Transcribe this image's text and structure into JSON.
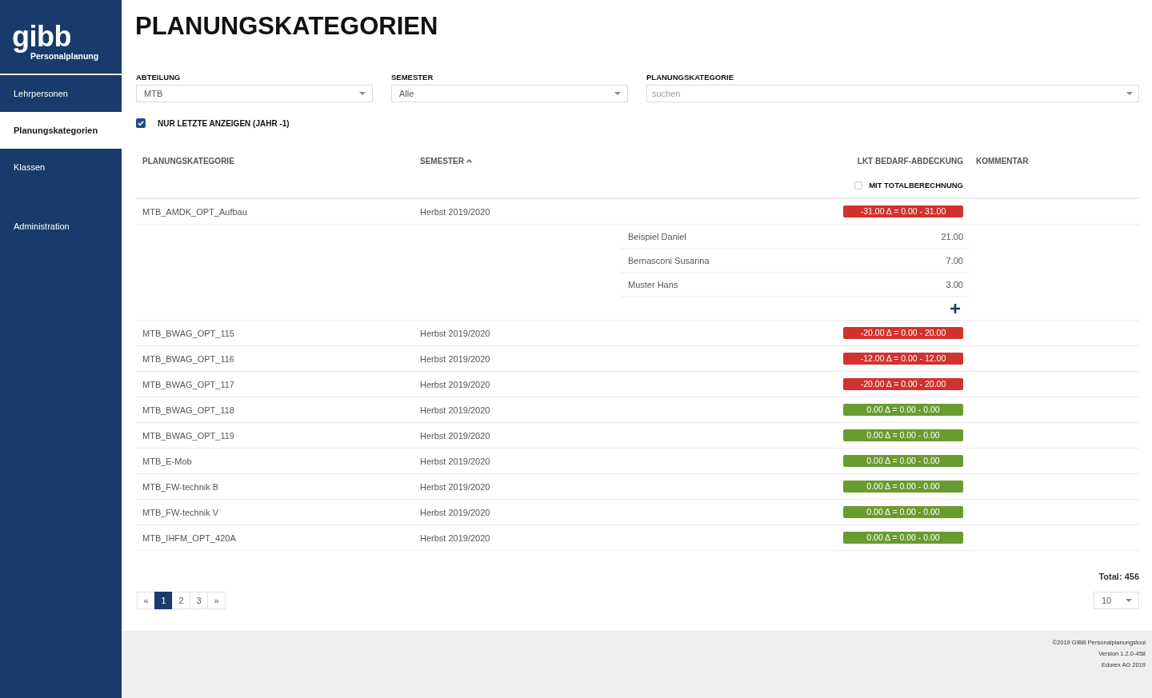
{
  "sidebar": {
    "logo": {
      "name": "gibb",
      "subtitle": "Personalplanung"
    },
    "sections": [
      {
        "items": [
          {
            "label": "Lehrpersonen",
            "selected": false
          },
          {
            "label": "Planungskategorien",
            "selected": true
          },
          {
            "label": "Klassen",
            "selected": false
          }
        ]
      },
      {
        "items": [
          {
            "label": "Administration",
            "selected": false
          }
        ]
      }
    ]
  },
  "page": {
    "title": "PLANUNGSKATEGORIEN"
  },
  "filters": {
    "fields": [
      {
        "label": "ABTEILUNG",
        "value": "MTB"
      },
      {
        "label": "SEMESTER",
        "value": "Alle"
      },
      {
        "label": "PLANUNGSKATEGORIE",
        "placeholder": "suchen"
      }
    ],
    "only_latest": {
      "label": "NUR LETZTE ANZEIGEN (JAHR -1)",
      "checked": true
    }
  },
  "table": {
    "columns": [
      {
        "label": "PLANUNGSKATEGORIE",
        "sorted": false
      },
      {
        "label": "SEMESTER",
        "sorted": true
      },
      {
        "label": "LKT BEDARF-ABDECKUNG",
        "sorted": false
      },
      {
        "label": "KOMMENTAR",
        "sorted": false
      }
    ],
    "total_calculation": {
      "label": "MIT TOTALBERECHNUNG",
      "checked": false
    },
    "rows": [
      {
        "name": "MTB_AMDK_OPT_Aufbau",
        "semester": "Herbst 2019/2020",
        "coverage": "-31.00 Δ = 0.00 - 31.00",
        "color": "#d2322d",
        "assignments": [
          {
            "name": "Beispiel Daniel",
            "value": "21.00"
          },
          {
            "name": "Bernasconi Susanna",
            "value": "7.00"
          },
          {
            "name": "Muster Hans",
            "value": "3.00"
          }
        ]
      },
      {
        "name": "MTB_BWAG_OPT_115",
        "semester": "Herbst 2019/2020",
        "coverage": "-20.00 Δ = 0.00 - 20.00",
        "color": "#d2322d"
      },
      {
        "name": "MTB_BWAG_OPT_116",
        "semester": "Herbst 2019/2020",
        "coverage": "-12.00 Δ = 0.00 - 12.00",
        "color": "#d2322d"
      },
      {
        "name": "MTB_BWAG_OPT_117",
        "semester": "Herbst 2019/2020",
        "coverage": "-20.00 Δ = 0.00 - 20.00",
        "color": "#d2322d"
      },
      {
        "name": "MTB_BWAG_OPT_118",
        "semester": "Herbst 2019/2020",
        "coverage": "0.00 Δ = 0.00 - 0.00",
        "color": "#6a9b2f"
      },
      {
        "name": "MTB_BWAG_OPT_119",
        "semester": "Herbst 2019/2020",
        "coverage": "0.00 Δ = 0.00 - 0.00",
        "color": "#6a9b2f"
      },
      {
        "name": "MTB_E-Mob",
        "semester": "Herbst 2019/2020",
        "coverage": "0.00 Δ = 0.00 - 0.00",
        "color": "#6a9b2f"
      },
      {
        "name": "MTB_FW-technik B",
        "semester": "Herbst 2019/2020",
        "coverage": "0.00 Δ = 0.00 - 0.00",
        "color": "#6a9b2f"
      },
      {
        "name": "MTB_FW-technik V",
        "semester": "Herbst 2019/2020",
        "coverage": "0.00 Δ = 0.00 - 0.00",
        "color": "#6a9b2f"
      },
      {
        "name": "MTB_IHFM_OPT_420A",
        "semester": "Herbst 2019/2020",
        "coverage": "0.00 Δ = 0.00 - 0.00",
        "color": "#6a9b2f"
      }
    ]
  },
  "pagination": {
    "previous": "«",
    "pages": [
      {
        "label": "1",
        "selected": true
      },
      {
        "label": "2",
        "selected": false
      },
      {
        "label": "3",
        "selected": false
      }
    ],
    "next": "»",
    "total": "Total: 456",
    "page_size": "10"
  },
  "footer": {
    "lines": [
      "©2019 GIBB Personalplanungstool",
      "Version 1.2.0-458",
      "Edorex AG 2019"
    ]
  }
}
